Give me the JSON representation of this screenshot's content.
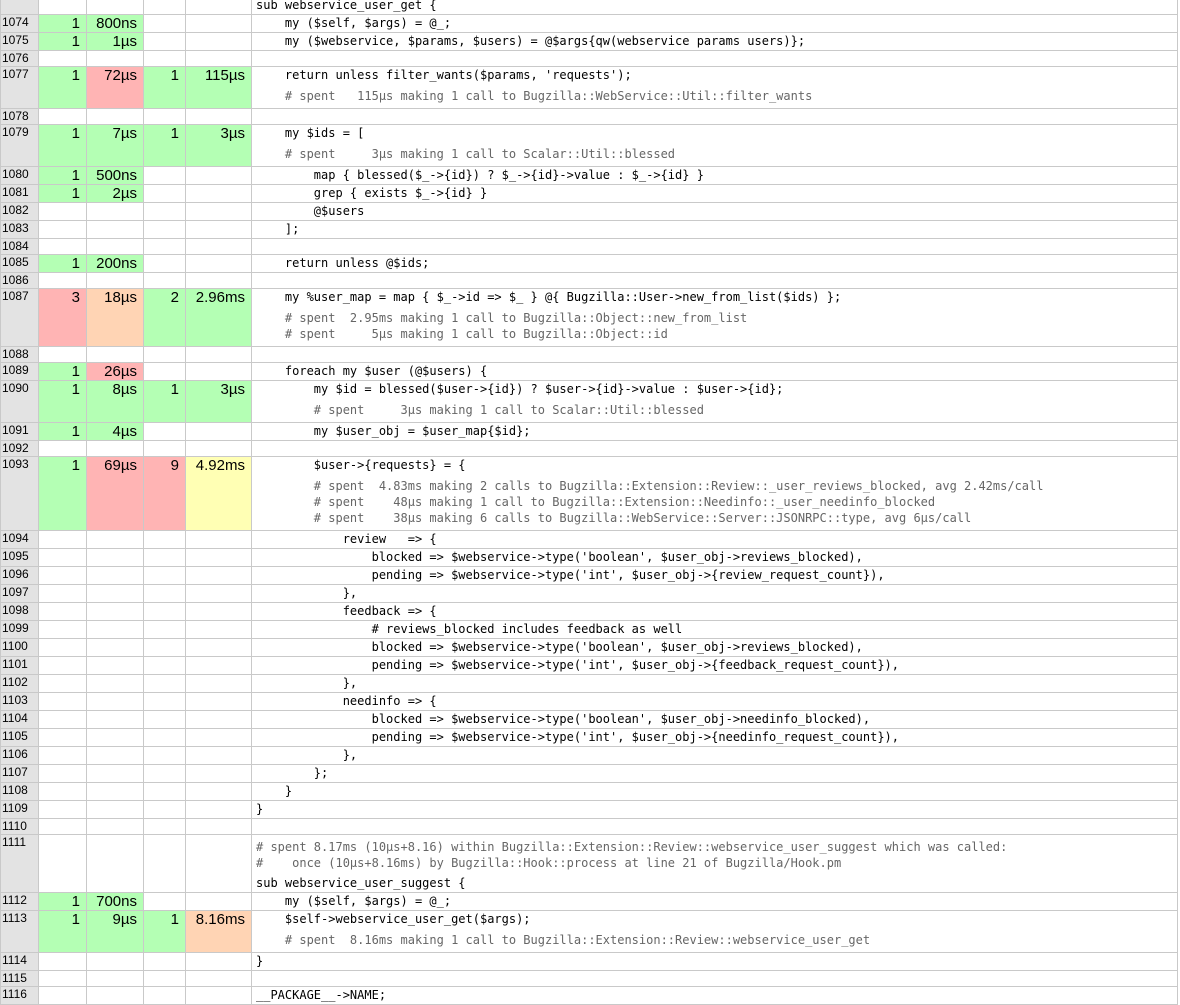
{
  "rows": [
    {
      "ln": "",
      "a": "",
      "b": "",
      "c": "",
      "d": "",
      "code": "sub webservice_user_get {",
      "cls": [
        "",
        "",
        "",
        ""
      ]
    },
    {
      "ln": "1074",
      "a": "1",
      "b": "800ns",
      "c": "",
      "d": "",
      "code": "    my ($self, $args) = @_;",
      "cls": [
        "g",
        "g",
        "",
        ""
      ]
    },
    {
      "ln": "1075",
      "a": "1",
      "b": "1µs",
      "c": "",
      "d": "",
      "code": "    my ($webservice, $params, $users) = @$args{qw(webservice params users)};",
      "cls": [
        "g",
        "g",
        "",
        ""
      ]
    },
    {
      "ln": "1076",
      "a": "",
      "b": "",
      "c": "",
      "d": "",
      "code": "",
      "cls": [
        "",
        "",
        "",
        ""
      ]
    },
    {
      "ln": "1077",
      "a": "1",
      "b": "72µs",
      "c": "1",
      "d": "115µs",
      "code": "    return unless filter_wants($params, 'requests');",
      "comments": [
        "    # spent   115µs making 1 call to Bugzilla::WebService::Util::filter_wants"
      ],
      "cls": [
        "g",
        "r",
        "g",
        "g"
      ]
    },
    {
      "ln": "1078",
      "a": "",
      "b": "",
      "c": "",
      "d": "",
      "code": "",
      "cls": [
        "",
        "",
        "",
        ""
      ]
    },
    {
      "ln": "1079",
      "a": "1",
      "b": "7µs",
      "c": "1",
      "d": "3µs",
      "code": "    my $ids = [",
      "comments": [
        "    # spent     3µs making 1 call to Scalar::Util::blessed"
      ],
      "cls": [
        "g",
        "g",
        "g",
        "g"
      ]
    },
    {
      "ln": "1080",
      "a": "1",
      "b": "500ns",
      "c": "",
      "d": "",
      "code": "        map { blessed($_->{id}) ? $_->{id}->value : $_->{id} }",
      "cls": [
        "g",
        "g",
        "",
        ""
      ]
    },
    {
      "ln": "1081",
      "a": "1",
      "b": "2µs",
      "c": "",
      "d": "",
      "code": "        grep { exists $_->{id} }",
      "cls": [
        "g",
        "g",
        "",
        ""
      ]
    },
    {
      "ln": "1082",
      "a": "",
      "b": "",
      "c": "",
      "d": "",
      "code": "        @$users",
      "cls": [
        "",
        "",
        "",
        ""
      ]
    },
    {
      "ln": "1083",
      "a": "",
      "b": "",
      "c": "",
      "d": "",
      "code": "    ];",
      "cls": [
        "",
        "",
        "",
        ""
      ]
    },
    {
      "ln": "1084",
      "a": "",
      "b": "",
      "c": "",
      "d": "",
      "code": "",
      "cls": [
        "",
        "",
        "",
        ""
      ]
    },
    {
      "ln": "1085",
      "a": "1",
      "b": "200ns",
      "c": "",
      "d": "",
      "code": "    return unless @$ids;",
      "cls": [
        "g",
        "g",
        "",
        ""
      ]
    },
    {
      "ln": "1086",
      "a": "",
      "b": "",
      "c": "",
      "d": "",
      "code": "",
      "cls": [
        "",
        "",
        "",
        ""
      ]
    },
    {
      "ln": "1087",
      "a": "3",
      "b": "18µs",
      "c": "2",
      "d": "2.96ms",
      "code": "    my %user_map = map { $_->id => $_ } @{ Bugzilla::User->new_from_list($ids) };",
      "comments": [
        "    # spent  2.95ms making 1 call to Bugzilla::Object::new_from_list",
        "    # spent     5µs making 1 call to Bugzilla::Object::id"
      ],
      "cls": [
        "r",
        "o",
        "g",
        "g"
      ]
    },
    {
      "ln": "1088",
      "a": "",
      "b": "",
      "c": "",
      "d": "",
      "code": "",
      "cls": [
        "",
        "",
        "",
        ""
      ]
    },
    {
      "ln": "1089",
      "a": "1",
      "b": "26µs",
      "c": "",
      "d": "",
      "code": "    foreach my $user (@$users) {",
      "cls": [
        "g",
        "r",
        "",
        ""
      ]
    },
    {
      "ln": "1090",
      "a": "1",
      "b": "8µs",
      "c": "1",
      "d": "3µs",
      "code": "        my $id = blessed($user->{id}) ? $user->{id}->value : $user->{id};",
      "comments": [
        "        # spent     3µs making 1 call to Scalar::Util::blessed"
      ],
      "cls": [
        "g",
        "g",
        "g",
        "g"
      ]
    },
    {
      "ln": "1091",
      "a": "1",
      "b": "4µs",
      "c": "",
      "d": "",
      "code": "        my $user_obj = $user_map{$id};",
      "cls": [
        "g",
        "g",
        "",
        ""
      ]
    },
    {
      "ln": "1092",
      "a": "",
      "b": "",
      "c": "",
      "d": "",
      "code": "",
      "cls": [
        "",
        "",
        "",
        ""
      ]
    },
    {
      "ln": "1093",
      "a": "1",
      "b": "69µs",
      "c": "9",
      "d": "4.92ms",
      "code": "        $user->{requests} = {",
      "comments": [
        "        # spent  4.83ms making 2 calls to Bugzilla::Extension::Review::_user_reviews_blocked, avg 2.42ms/call",
        "        # spent    48µs making 1 call to Bugzilla::Extension::Needinfo::_user_needinfo_blocked",
        "        # spent    38µs making 6 calls to Bugzilla::WebService::Server::JSONRPC::type, avg 6µs/call"
      ],
      "cls": [
        "g",
        "r",
        "r",
        "y"
      ]
    },
    {
      "ln": "1094",
      "a": "",
      "b": "",
      "c": "",
      "d": "",
      "code": "            review   => {",
      "cls": [
        "",
        "",
        "",
        ""
      ]
    },
    {
      "ln": "1095",
      "a": "",
      "b": "",
      "c": "",
      "d": "",
      "code": "                blocked => $webservice->type('boolean', $user_obj->reviews_blocked),",
      "cls": [
        "",
        "",
        "",
        ""
      ]
    },
    {
      "ln": "1096",
      "a": "",
      "b": "",
      "c": "",
      "d": "",
      "code": "                pending => $webservice->type('int', $user_obj->{review_request_count}),",
      "cls": [
        "",
        "",
        "",
        ""
      ]
    },
    {
      "ln": "1097",
      "a": "",
      "b": "",
      "c": "",
      "d": "",
      "code": "            },",
      "cls": [
        "",
        "",
        "",
        ""
      ]
    },
    {
      "ln": "1098",
      "a": "",
      "b": "",
      "c": "",
      "d": "",
      "code": "            feedback => {",
      "cls": [
        "",
        "",
        "",
        ""
      ]
    },
    {
      "ln": "1099",
      "a": "",
      "b": "",
      "c": "",
      "d": "",
      "code": "                # reviews_blocked includes feedback as well",
      "cls": [
        "",
        "",
        "",
        ""
      ]
    },
    {
      "ln": "1100",
      "a": "",
      "b": "",
      "c": "",
      "d": "",
      "code": "                blocked => $webservice->type('boolean', $user_obj->reviews_blocked),",
      "cls": [
        "",
        "",
        "",
        ""
      ]
    },
    {
      "ln": "1101",
      "a": "",
      "b": "",
      "c": "",
      "d": "",
      "code": "                pending => $webservice->type('int', $user_obj->{feedback_request_count}),",
      "cls": [
        "",
        "",
        "",
        ""
      ]
    },
    {
      "ln": "1102",
      "a": "",
      "b": "",
      "c": "",
      "d": "",
      "code": "            },",
      "cls": [
        "",
        "",
        "",
        ""
      ]
    },
    {
      "ln": "1103",
      "a": "",
      "b": "",
      "c": "",
      "d": "",
      "code": "            needinfo => {",
      "cls": [
        "",
        "",
        "",
        ""
      ]
    },
    {
      "ln": "1104",
      "a": "",
      "b": "",
      "c": "",
      "d": "",
      "code": "                blocked => $webservice->type('boolean', $user_obj->needinfo_blocked),",
      "cls": [
        "",
        "",
        "",
        ""
      ]
    },
    {
      "ln": "1105",
      "a": "",
      "b": "",
      "c": "",
      "d": "",
      "code": "                pending => $webservice->type('int', $user_obj->{needinfo_request_count}),",
      "cls": [
        "",
        "",
        "",
        ""
      ]
    },
    {
      "ln": "1106",
      "a": "",
      "b": "",
      "c": "",
      "d": "",
      "code": "            },",
      "cls": [
        "",
        "",
        "",
        ""
      ]
    },
    {
      "ln": "1107",
      "a": "",
      "b": "",
      "c": "",
      "d": "",
      "code": "        };",
      "cls": [
        "",
        "",
        "",
        ""
      ]
    },
    {
      "ln": "1108",
      "a": "",
      "b": "",
      "c": "",
      "d": "",
      "code": "    }",
      "cls": [
        "",
        "",
        "",
        ""
      ]
    },
    {
      "ln": "1109",
      "a": "",
      "b": "",
      "c": "",
      "d": "",
      "code": "}",
      "cls": [
        "",
        "",
        "",
        ""
      ]
    },
    {
      "ln": "1110",
      "a": "",
      "b": "",
      "c": "",
      "d": "",
      "code": "",
      "cls": [
        "",
        "",
        "",
        ""
      ]
    },
    {
      "ln": "1111",
      "a": "",
      "b": "",
      "c": "",
      "d": "",
      "precomments": [
        "# spent 8.17ms (10µs+8.16) within Bugzilla::Extension::Review::webservice_user_suggest which was called:",
        "#    once (10µs+8.16ms) by Bugzilla::Hook::process at line 21 of Bugzilla/Hook.pm"
      ],
      "code": "sub webservice_user_suggest {",
      "cls": [
        "",
        "",
        "",
        ""
      ]
    },
    {
      "ln": "1112",
      "a": "1",
      "b": "700ns",
      "c": "",
      "d": "",
      "code": "    my ($self, $args) = @_;",
      "cls": [
        "g",
        "g",
        "",
        ""
      ]
    },
    {
      "ln": "1113",
      "a": "1",
      "b": "9µs",
      "c": "1",
      "d": "8.16ms",
      "code": "    $self->webservice_user_get($args);",
      "comments": [
        "    # spent  8.16ms making 1 call to Bugzilla::Extension::Review::webservice_user_get"
      ],
      "cls": [
        "g",
        "g",
        "g",
        "o"
      ]
    },
    {
      "ln": "1114",
      "a": "",
      "b": "",
      "c": "",
      "d": "",
      "code": "}",
      "cls": [
        "",
        "",
        "",
        ""
      ]
    },
    {
      "ln": "1115",
      "a": "",
      "b": "",
      "c": "",
      "d": "",
      "code": "",
      "cls": [
        "",
        "",
        "",
        ""
      ]
    },
    {
      "ln": "1116",
      "a": "",
      "b": "",
      "c": "",
      "d": "",
      "code": "__PACKAGE__->NAME;",
      "cls": [
        "",
        "",
        "",
        ""
      ]
    }
  ]
}
